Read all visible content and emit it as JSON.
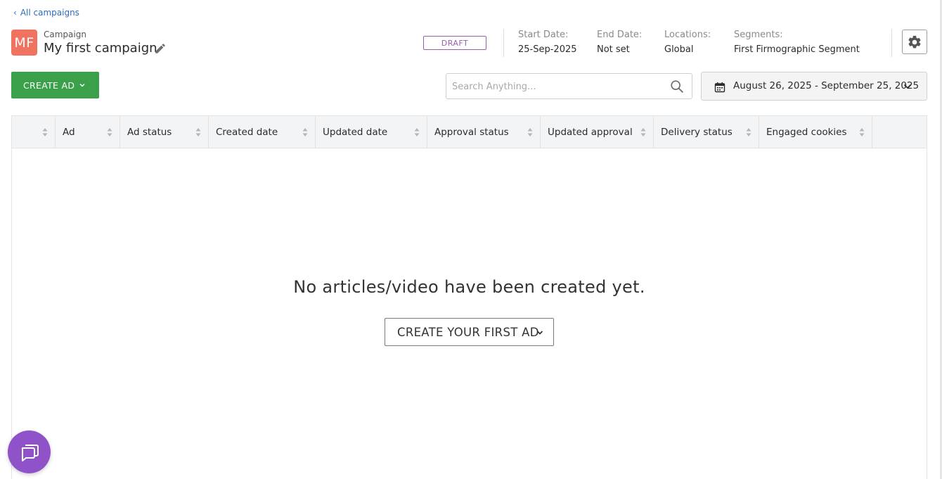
{
  "breadcrumb": {
    "label": "All campaigns"
  },
  "campaign": {
    "avatar_initials": "MF",
    "avatar_color": "#f0735f",
    "kicker": "Campaign",
    "title": "My first campaign",
    "status": "DRAFT",
    "status_color": "#9b5bb0"
  },
  "meta": {
    "start_label": "Start Date:",
    "start_value": "25-Sep-2025",
    "end_label": "End Date:",
    "end_value": "Not set",
    "locations_label": "Locations:",
    "locations_value": "Global",
    "segments_label": "Segments:",
    "segments_value": "First Firmographic Segment"
  },
  "toolbar": {
    "create_ad_label": "CREATE AD",
    "create_ad_color": "#3aa14a",
    "search_placeholder": "Search Anything...",
    "date_range": "August 26, 2025 - September 25, 2025"
  },
  "table": {
    "columns": [
      {
        "label": ""
      },
      {
        "label": "Ad"
      },
      {
        "label": "Ad status"
      },
      {
        "label": "Created date"
      },
      {
        "label": "Updated date"
      },
      {
        "label": "Approval status"
      },
      {
        "label": "Updated approval"
      },
      {
        "label": "Delivery status"
      },
      {
        "label": "Engaged cookies"
      }
    ],
    "empty_message": "No articles/video have been created yet.",
    "create_first_label": "CREATE YOUR FIRST AD"
  },
  "chat": {
    "icon": "chat-icon",
    "color": "#8f52c9"
  }
}
